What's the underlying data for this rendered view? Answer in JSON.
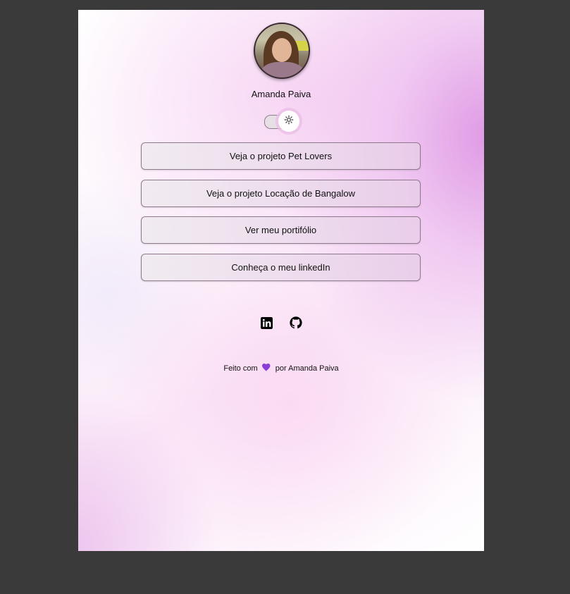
{
  "profile": {
    "name": "Amanda Paiva"
  },
  "theme_toggle": {
    "mode": "light",
    "icon": "sun-icon"
  },
  "links": [
    {
      "label": "Veja o projeto Pet Lovers"
    },
    {
      "label": "Veja o projeto Locação de Bangalow"
    },
    {
      "label": "Ver meu portifólio"
    },
    {
      "label": "Conheça o meu linkedIn"
    }
  ],
  "social": [
    {
      "icon": "linkedin-icon"
    },
    {
      "icon": "github-icon"
    }
  ],
  "footer": {
    "text_before": "Feito com",
    "heart_icon": "heart-icon",
    "heart_color": "#8a3fd6",
    "text_after": "por Amanda Paiva"
  },
  "colors": {
    "accent_pink": "#e3a6e8",
    "background_outer": "#3a3a3a"
  }
}
